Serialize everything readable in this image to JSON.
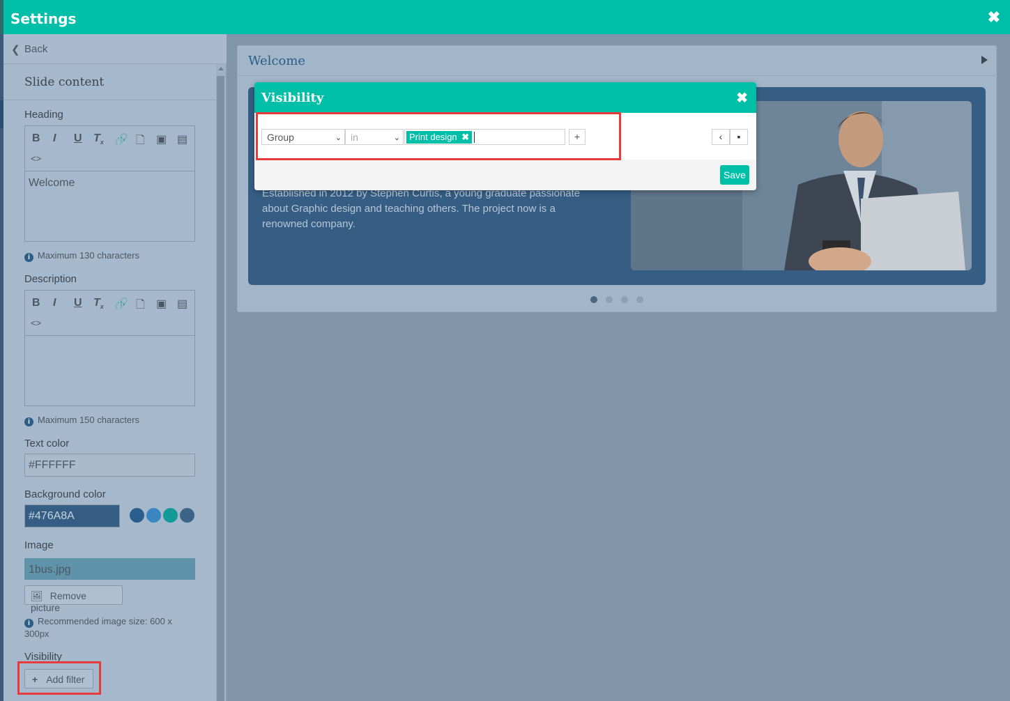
{
  "window": {
    "title": "Settings"
  },
  "sidebar": {
    "back_label": "Back",
    "section_title": "Slide content",
    "heading": {
      "label": "Heading",
      "value": "Welcome",
      "hint": "Maximum 130 characters"
    },
    "description": {
      "label": "Description",
      "value": "",
      "hint": "Maximum 150 characters"
    },
    "text_color": {
      "label": "Text color",
      "value": "#FFFFFF"
    },
    "background_color": {
      "label": "Background color",
      "value": "#476A8A",
      "swatches": [
        "#2a5e8c",
        "#3a86c0",
        "#119a96",
        "#3d6387"
      ]
    },
    "image": {
      "label": "Image",
      "value": "1bus.jpg",
      "remove_label": "Remove picture",
      "hint": "Recommended image size: 600 x 300px"
    },
    "visibility": {
      "label": "Visibility",
      "add_filter_label": "Add filter"
    },
    "editor_toolbar": [
      "bold-icon",
      "italic-icon",
      "underline-icon",
      "clear-format-icon",
      "link-icon",
      "file-icon",
      "image-icon",
      "table-icon",
      "code-icon"
    ]
  },
  "preview": {
    "panel_title": "Welcome",
    "slide_text": "Established in 2012 by Stephen Curtis, a young graduate passionate about Graphic design and teaching others. The project now is a renowned company.",
    "dots_total": 4,
    "active_dot": 1
  },
  "modal": {
    "title": "Visibility",
    "field_select": "Group",
    "operator_select": "in",
    "tag": "Print design",
    "add_label": "+",
    "save_label": "Save"
  },
  "colors": {
    "accent": "#00bfa8",
    "highlight": "#e83a3a"
  }
}
